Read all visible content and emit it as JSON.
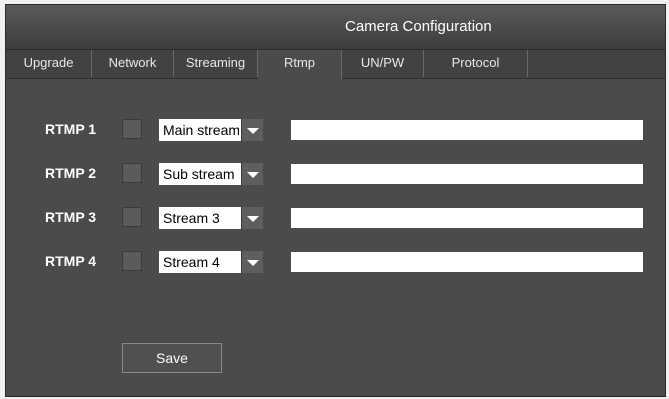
{
  "window": {
    "title": "Camera Configuration"
  },
  "tabs": [
    {
      "label": "Upgrade"
    },
    {
      "label": "Network"
    },
    {
      "label": "Streaming"
    },
    {
      "label": "Rtmp",
      "active": true
    },
    {
      "label": "UN/PW"
    },
    {
      "label": "Protocol"
    }
  ],
  "rtmp_rows": [
    {
      "label": "RTMP 1",
      "checked": false,
      "stream": "Main stream",
      "url": ""
    },
    {
      "label": "RTMP 2",
      "checked": false,
      "stream": "Sub stream",
      "url": ""
    },
    {
      "label": "RTMP 3",
      "checked": false,
      "stream": "Stream 3",
      "url": ""
    },
    {
      "label": "RTMP 4",
      "checked": false,
      "stream": "Stream 4",
      "url": ""
    }
  ],
  "actions": {
    "save_label": "Save"
  },
  "colors": {
    "panel": "#4b4b4b",
    "titlebar": "#3d3d3d",
    "text": "#ffffff"
  }
}
